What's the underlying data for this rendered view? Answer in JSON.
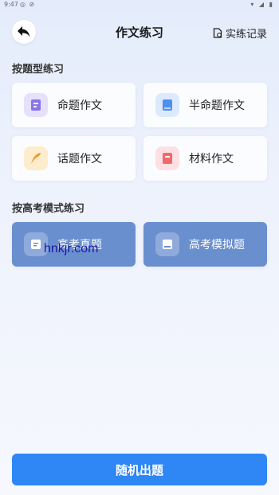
{
  "status_bar": {
    "time": "9:47",
    "left_icons": "◎ ⊘",
    "right_icons": "▾ ◢ ▮"
  },
  "header": {
    "title": "作文练习",
    "record_label": "实练记录"
  },
  "section1": {
    "title": "按题型练习",
    "cards": [
      {
        "label": "命题作文",
        "icon": "book-purple-icon",
        "color": "#8a74e6"
      },
      {
        "label": "半命题作文",
        "icon": "book-blue-icon",
        "color": "#4e8ff2"
      },
      {
        "label": "话题作文",
        "icon": "feather-orange-icon",
        "color": "#f09a2c"
      },
      {
        "label": "材料作文",
        "icon": "book-red-icon",
        "color": "#f06a6a"
      }
    ]
  },
  "section2": {
    "title": "按高考模式练习",
    "cards": [
      {
        "label": "高考真题",
        "icon": "exam-icon"
      },
      {
        "label": "高考模拟题",
        "icon": "mock-exam-icon"
      }
    ]
  },
  "watermark": "hnkjr.com",
  "random_button": "随机出题"
}
